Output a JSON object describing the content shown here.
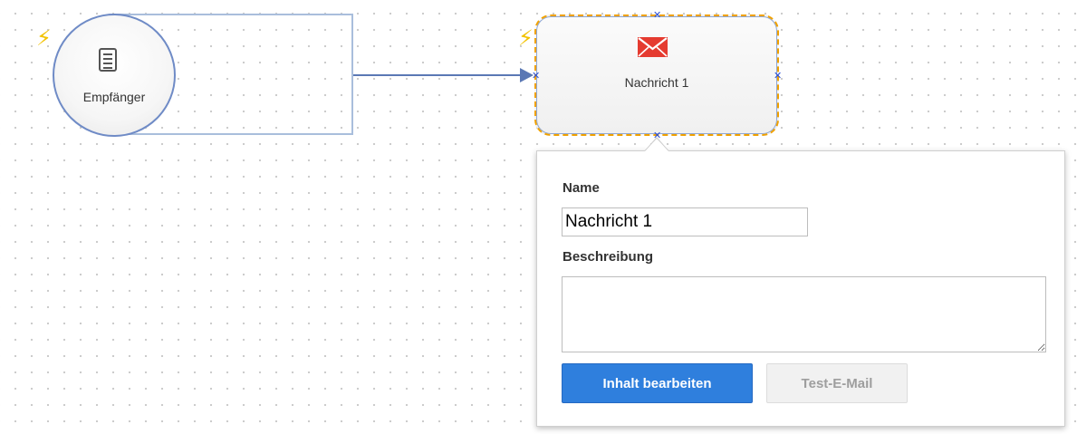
{
  "canvas": {
    "start_node": {
      "label": "Empfänger",
      "icon": "document-list-icon",
      "trigger_icon": "lightning-bolt-icon"
    },
    "message_node": {
      "label": "Nachricht 1",
      "icon": "mail-envelope-icon",
      "trigger_icon": "lightning-bolt-icon",
      "selected": true
    },
    "colors": {
      "connector": "#5b78b4",
      "selection": "#f0a100",
      "mail_icon": "#e53b30",
      "primary_button": "#2f7fdd"
    }
  },
  "panel": {
    "name_label": "Name",
    "name_value": "Nachricht 1",
    "description_label": "Beschreibung",
    "description_value": "",
    "edit_button": "Inhalt bearbeiten",
    "test_button": "Test-E-Mail"
  }
}
